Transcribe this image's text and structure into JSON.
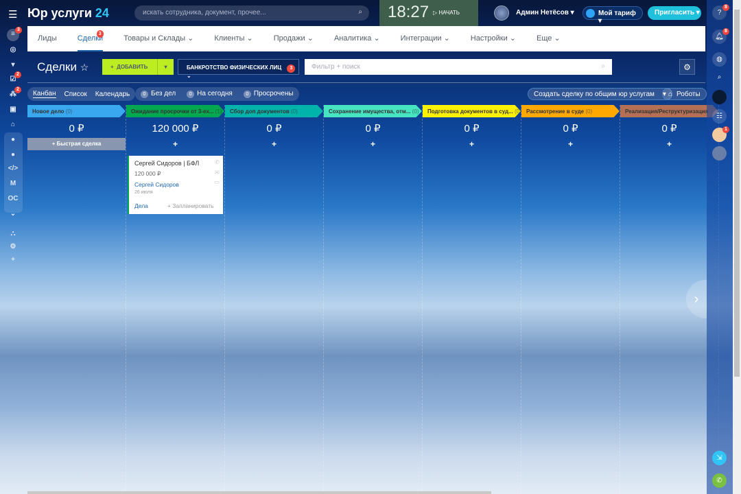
{
  "header": {
    "logo": "Юр услуги",
    "logo_num": "24",
    "search_placeholder": "искать сотрудника, документ, прочее...",
    "time": "18:27",
    "start": "НАЧАТЬ",
    "user": "Админ Нетёсов",
    "tarif": "Мой тариф",
    "invite": "Пригласить"
  },
  "leftbar": {
    "badges": [
      "3",
      "2",
      "2"
    ],
    "labels": [
      "M",
      "OC"
    ]
  },
  "menu": [
    {
      "label": "Лиды"
    },
    {
      "label": "Сделки",
      "badge": "3"
    },
    {
      "label": "Товары и Склады ⌄"
    },
    {
      "label": "Клиенты ⌄"
    },
    {
      "label": "Продажи ⌄"
    },
    {
      "label": "Аналитика ⌄"
    },
    {
      "label": "Интеграции ⌄"
    },
    {
      "label": "Настройки ⌄"
    },
    {
      "label": "Еще ⌄"
    }
  ],
  "toolbar": {
    "title": "Сделки",
    "add": "ДОБАВИТЬ",
    "category": "БАНКРОТСТВО ФИЗИЧЕСКИХ ЛИЦ",
    "category_badge": "3",
    "filter_placeholder": "Фильтр + поиск"
  },
  "views": [
    "Канбан",
    "Список",
    "Календарь"
  ],
  "counters": [
    {
      "n": "0",
      "label": "Без дел"
    },
    {
      "n": "0",
      "label": "На сегодня"
    },
    {
      "n": "0",
      "label": "Просрочены"
    }
  ],
  "create_deal": "Создать сделку по общим юр услугам",
  "robots": "Роботы",
  "quick_deal": "Быстрая сделка",
  "columns": [
    {
      "title": "Новое дело",
      "count": "(0)",
      "sum": "0 ₽",
      "color": "#39a8ef"
    },
    {
      "title": "Ожидание просрочки от 3-ех...",
      "count": "(1)",
      "sum": "120 000 ₽",
      "color": "#00a94f"
    },
    {
      "title": "Сбор доп документов",
      "count": "(0)",
      "sum": "0 ₽",
      "color": "#00b4ac"
    },
    {
      "title": "Сохранение имущества, отм...",
      "count": "(0)",
      "sum": "0 ₽",
      "color": "#47e4c2"
    },
    {
      "title": "Подготовка документов в суд...",
      "count": "(0)",
      "sum": "0 ₽",
      "color": "#fff200"
    },
    {
      "title": "Рассмотрение в суде",
      "count": "(0)",
      "sum": "0 ₽",
      "color": "#ffa900"
    },
    {
      "title": "Реализация/Реструктуризация",
      "count": "",
      "sum": "0 ₽",
      "color": "#b37055"
    }
  ],
  "card": {
    "title": "Сергей Сидоров | БФЛ",
    "amount": "120 000 ₽",
    "contact": "Сергей Сидоров",
    "date": "26 июля",
    "tasks": "Дела",
    "plan": "+ Запланировать"
  },
  "rightbar": {
    "badges": [
      "8",
      "8",
      "1"
    ]
  }
}
